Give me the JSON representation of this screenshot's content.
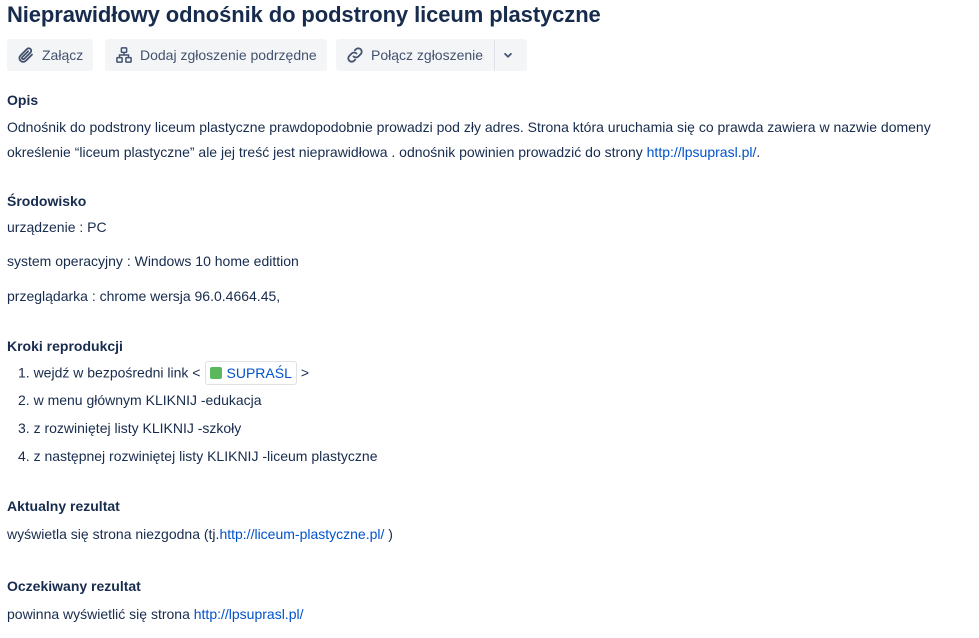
{
  "issue": {
    "title": "Nieprawidłowy odnośnik do podstrony liceum plastyczne"
  },
  "toolbar": {
    "attach_label": "Załącz",
    "add_child_label": "Dodaj zgłoszenie podrzędne",
    "link_issue_label": "Połącz zgłoszenie"
  },
  "description": {
    "heading": "Opis",
    "line1": "Odnośnik do podstrony liceum plastyczne prawdopodobnie prowadzi pod zły adres. Strona która uruchamia się co prawda zawiera w nazwie domeny",
    "line2_text": "określenie “liceum plastyczne” ale jej treść jest nieprawidłowa . odnośnik powinien prowadzić do strony ",
    "line2_link": "http://lpsuprasl.pl/",
    "line2_end": "."
  },
  "environment": {
    "heading": "Środowisko",
    "device": "urządzenie : PC",
    "os": "system operacyjny : Windows 10 home edittion",
    "browser": "przeglądarka : chrome wersja 96.0.4664.45,"
  },
  "steps": {
    "heading": "Kroki reprodukcji",
    "step1_prefix": "1. wejdź w bezpośredni link <",
    "step1_card": "SUPRAŚL",
    "step1_suffix": ">",
    "step2": "2.  w menu głównym KLIKNIJ -edukacja",
    "step3": "3. z rozwiniętej listy KLIKNIJ -szkoły",
    "step4": "4. z następnej rozwiniętej listy KLIKNIJ -liceum plastyczne"
  },
  "actual": {
    "heading": "Aktualny rezultat",
    "prefix": "wyświetla się strona niezgodna (tj.",
    "link": "http://liceum-plastyczne.pl/",
    "suffix": " )"
  },
  "expected": {
    "heading": "Oczekiwany rezultat",
    "prefix": "powinna wyświetlić się strona ",
    "link": "http://lpsuprasl.pl/"
  },
  "icons": {
    "attach": "paperclip-icon",
    "child": "hierarchy-icon",
    "link": "link-icon",
    "more": "chevron-down-icon"
  },
  "colors": {
    "link": "#0052cc",
    "text": "#172b4d",
    "button_bg": "#f4f5f7",
    "card_favicon": "#5cb85c"
  }
}
